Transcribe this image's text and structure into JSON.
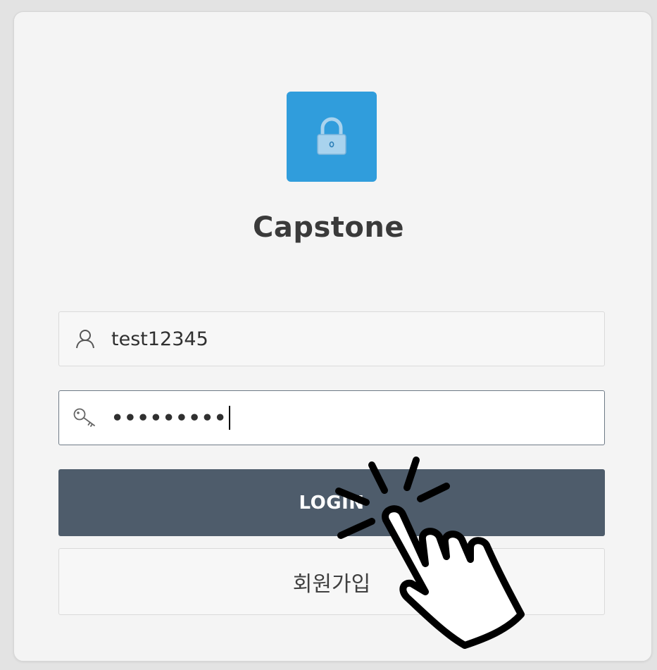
{
  "app": {
    "title": "Capstone"
  },
  "logo": {
    "icon": "lock-icon",
    "tile_color": "#309ddc"
  },
  "login_form": {
    "username": {
      "icon": "user-icon",
      "value": "test12345"
    },
    "password": {
      "icon": "key-icon",
      "masked_value": "•••••••••"
    },
    "login_button": {
      "label": "LOGIN",
      "color": "#4e5c6b"
    },
    "signup_button": {
      "label": "회원가입"
    }
  },
  "overlay": {
    "icon": "tap-hand-icon"
  }
}
